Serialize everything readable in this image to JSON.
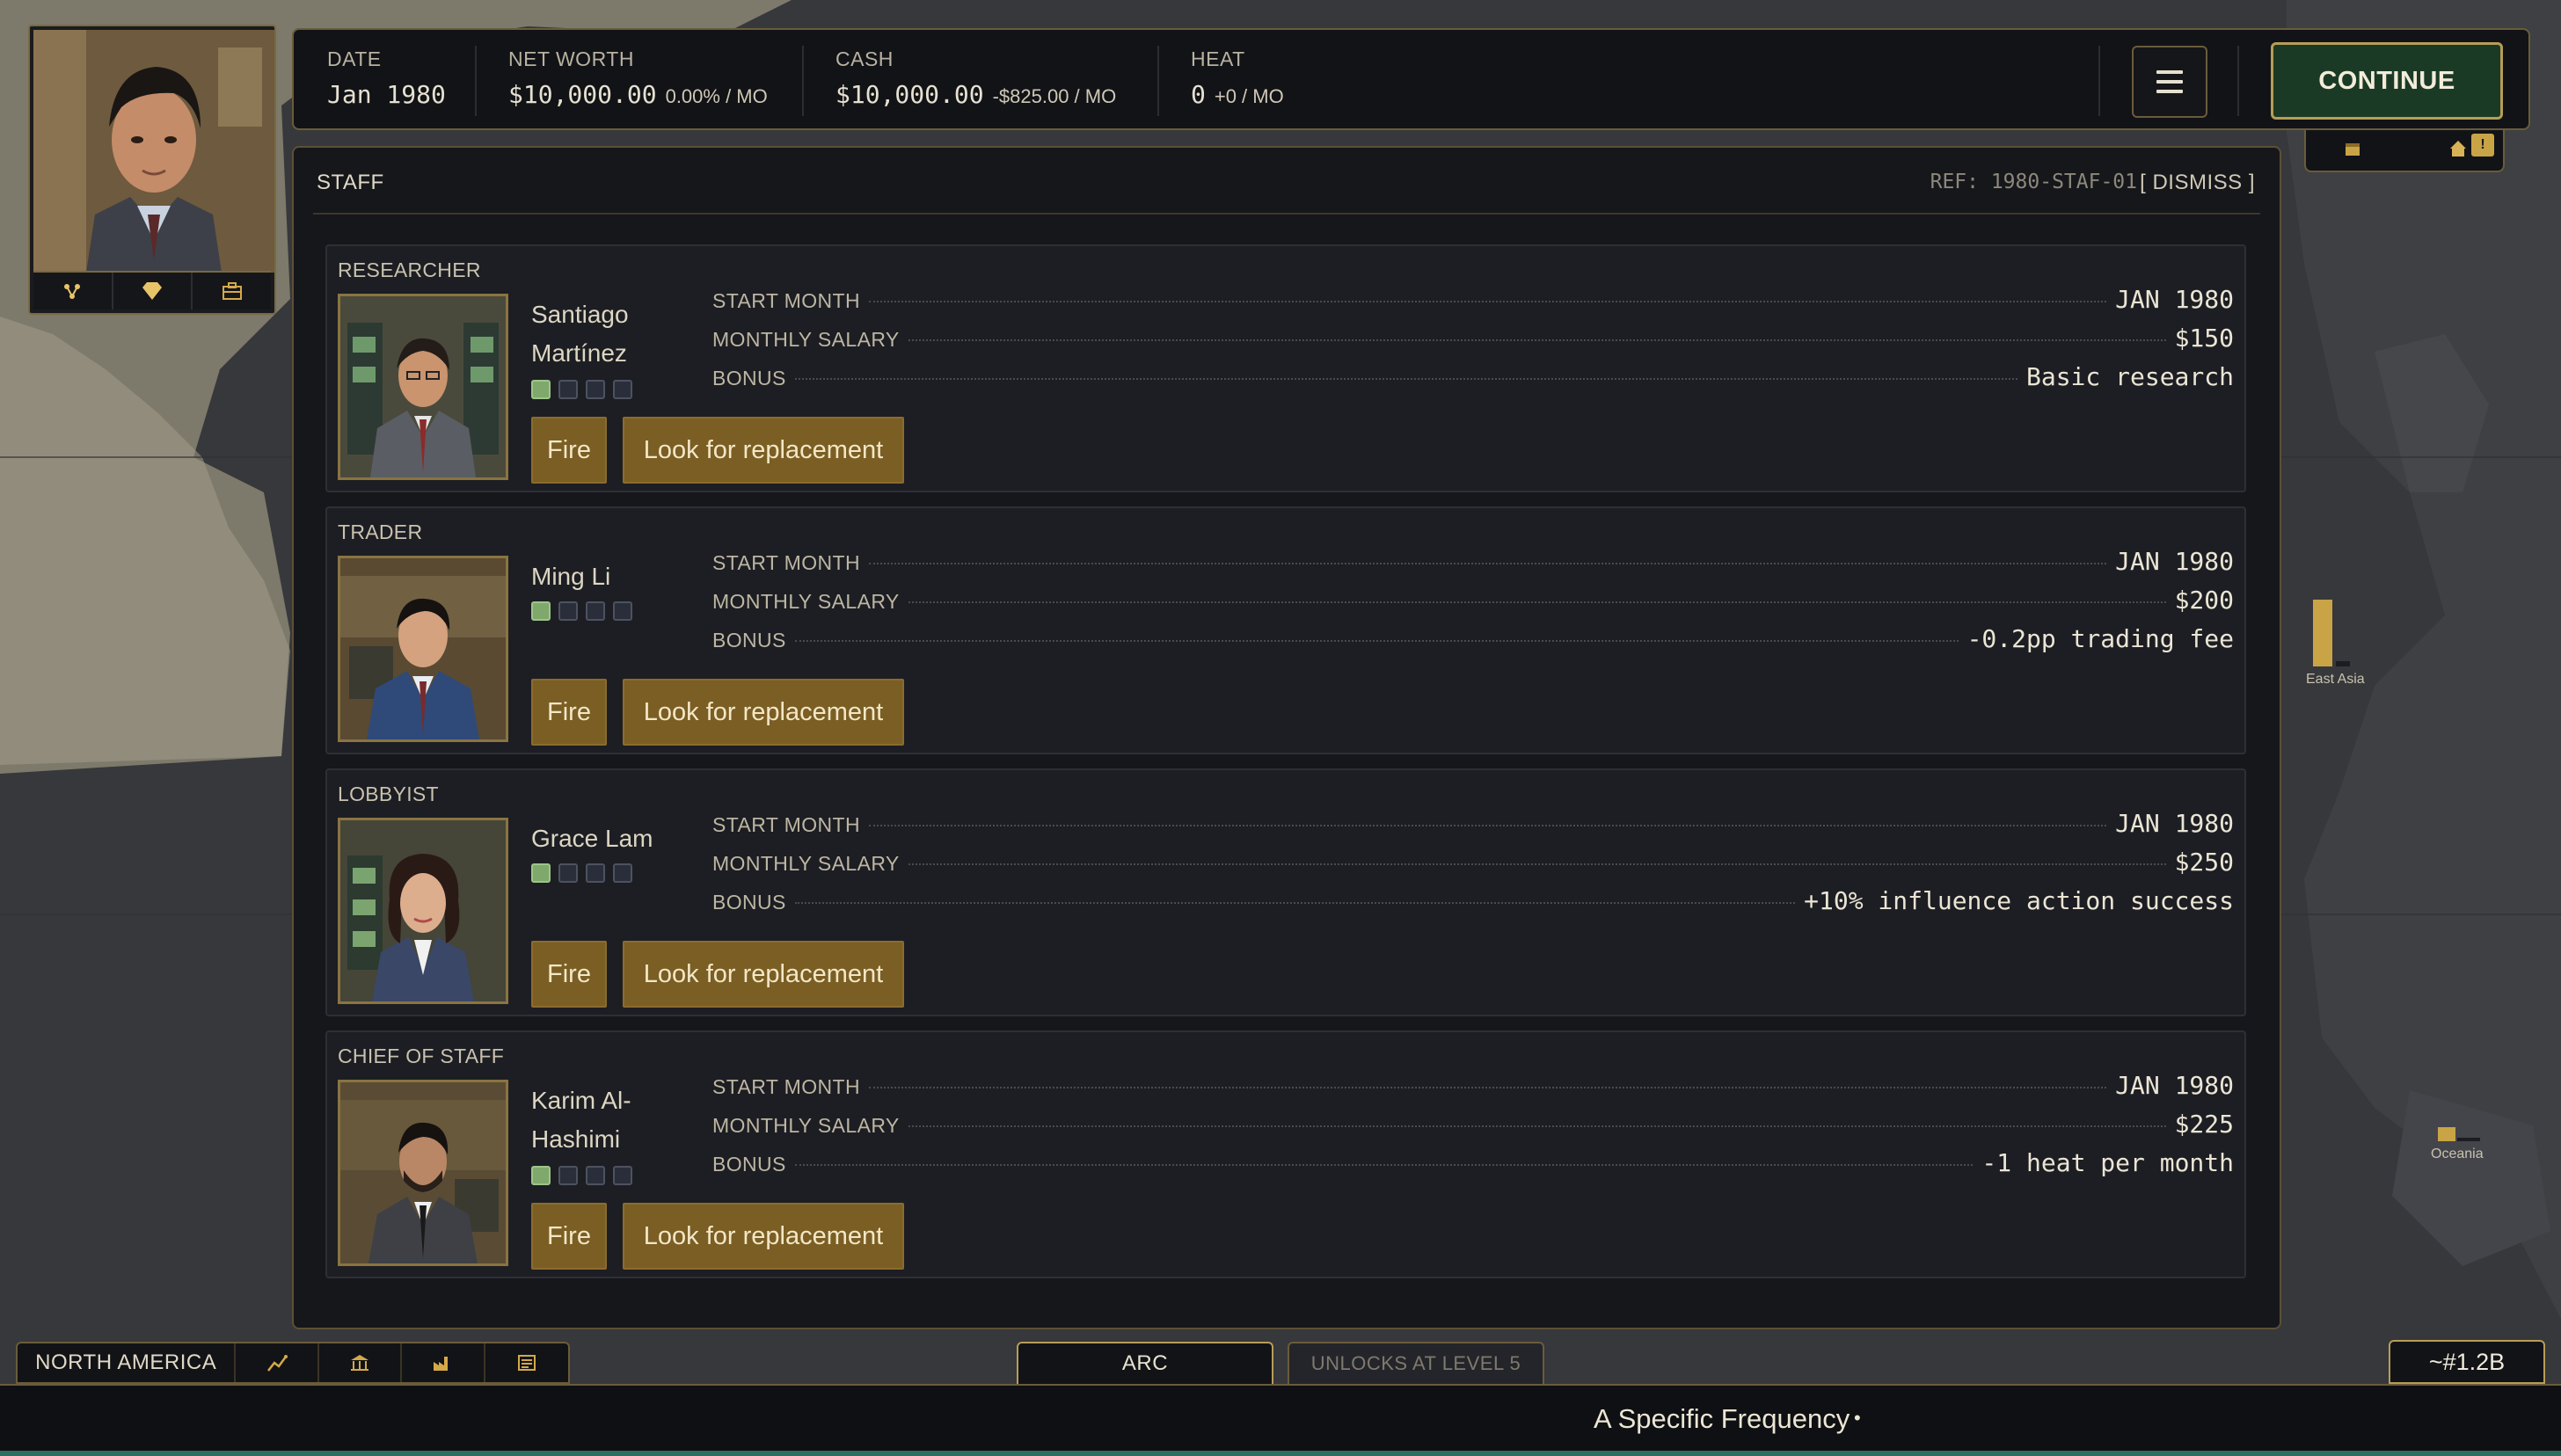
{
  "stats": {
    "date": {
      "label": "DATE",
      "value": "Jan 1980"
    },
    "net_worth": {
      "label": "NET WORTH",
      "value": "$10,000.00",
      "sub": "0.00% / MO"
    },
    "cash": {
      "label": "CASH",
      "value": "$10,000.00",
      "sub": "-$825.00 / MO"
    },
    "heat": {
      "label": "HEAT",
      "value": "0",
      "sub": "+0 / MO"
    }
  },
  "toolbar": {
    "continue_label": "CONTINUE"
  },
  "panel": {
    "title": "STAFF",
    "ref": "REF: 1980-STAF-01",
    "dismiss_label": "[ DISMISS ]",
    "field_labels": {
      "start": "START MONTH",
      "salary": "MONTHLY SALARY",
      "bonus": "BONUS"
    },
    "fire_label": "Fire",
    "replace_label": "Look for replacement"
  },
  "staff": [
    {
      "role": "RESEARCHER",
      "name": "Santiago Martínez",
      "start_month": "JAN 1980",
      "salary": "$150",
      "bonus": "Basic research",
      "level": 1,
      "max_level": 4
    },
    {
      "role": "TRADER",
      "name": "Ming Li",
      "start_month": "JAN 1980",
      "salary": "$200",
      "bonus": "-0.2pp trading fee",
      "level": 1,
      "max_level": 4
    },
    {
      "role": "LOBBYIST",
      "name": "Grace Lam",
      "start_month": "JAN 1980",
      "salary": "$250",
      "bonus": "+10% influence action success",
      "level": 1,
      "max_level": 4
    },
    {
      "role": "CHIEF OF STAFF",
      "name": "Karim Al-Hashimi",
      "start_month": "JAN 1980",
      "salary": "$225",
      "bonus": "-1 heat per month",
      "level": 1,
      "max_level": 4
    }
  ],
  "map": {
    "region_labels": [
      "East Asia",
      "Oceania"
    ]
  },
  "bottom": {
    "region_tab": "NORTH AMERICA",
    "arc_tab": "ARC",
    "locked_tab": "UNLOCKS AT LEVEL 5",
    "counter": "~#1.2B",
    "ticker": "A Specific Frequency",
    "ticker_sep": "•"
  },
  "icons": {
    "avatar_tools": [
      "network-icon",
      "diamond-icon",
      "briefcase-icon"
    ],
    "bottom_tools": [
      "chart-icon",
      "bank-icon",
      "factory-icon",
      "newspaper-icon"
    ],
    "mini_widget": [
      "calendar-icon",
      "house-icon",
      "alert-icon"
    ]
  },
  "colors": {
    "accent_gold": "#b79d57",
    "continue_green": "#1b3a26",
    "button_gold": "#7a5e24",
    "pip_on": "#7fa86c"
  }
}
